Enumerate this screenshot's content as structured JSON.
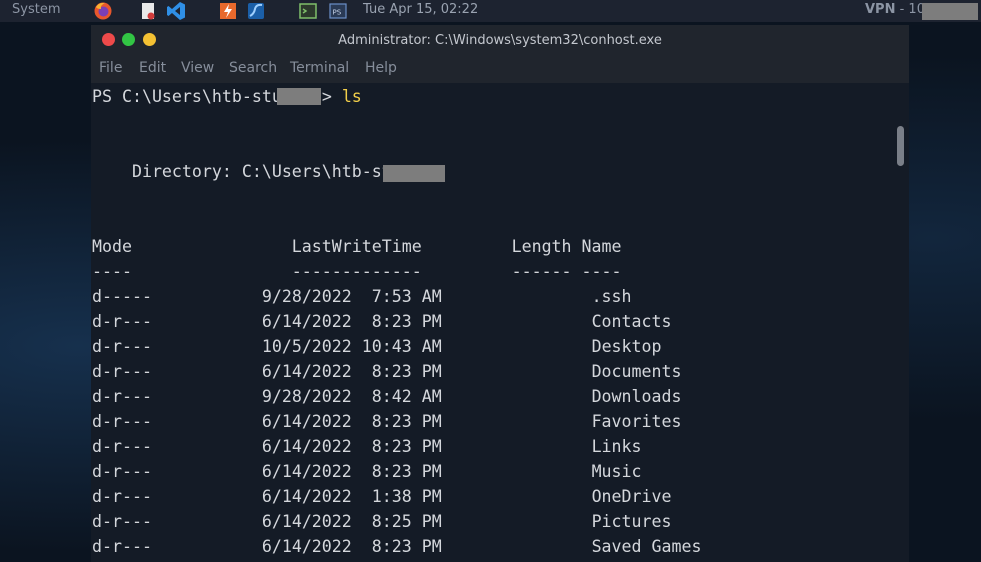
{
  "panel": {
    "menu_label": "System",
    "clock": "Tue Apr 15, 02:22",
    "vpn_label": "VPN",
    "vpn_ip": " - 10."
  },
  "window": {
    "title": "Administrator: C:\\Windows\\system32\\conhost.exe",
    "menu": [
      "File",
      "Edit",
      "View",
      "Search",
      "Terminal",
      "Help"
    ]
  },
  "terminal": {
    "prompt_prefix": "PS C:\\Users\\htb-stu",
    "prompt_suffix": "> ",
    "command": "ls",
    "directory_label": "    Directory: C:\\Users\\htb-st",
    "header": "Mode                LastWriteTime         Length Name",
    "separator": "----                -------------         ------ ----",
    "rows": [
      {
        "mode": "d-----",
        "date": "9/28/2022",
        "time": "7:53 AM",
        "length": "",
        "name": ".ssh"
      },
      {
        "mode": "d-r---",
        "date": "6/14/2022",
        "time": "8:23 PM",
        "length": "",
        "name": "Contacts"
      },
      {
        "mode": "d-r---",
        "date": "10/5/2022",
        "time": "10:43 AM",
        "length": "",
        "name": "Desktop"
      },
      {
        "mode": "d-r---",
        "date": "6/14/2022",
        "time": "8:23 PM",
        "length": "",
        "name": "Documents"
      },
      {
        "mode": "d-r---",
        "date": "9/28/2022",
        "time": "8:42 AM",
        "length": "",
        "name": "Downloads"
      },
      {
        "mode": "d-r---",
        "date": "6/14/2022",
        "time": "8:23 PM",
        "length": "",
        "name": "Favorites"
      },
      {
        "mode": "d-r---",
        "date": "6/14/2022",
        "time": "8:23 PM",
        "length": "",
        "name": "Links"
      },
      {
        "mode": "d-r---",
        "date": "6/14/2022",
        "time": "8:23 PM",
        "length": "",
        "name": "Music"
      },
      {
        "mode": "d-r---",
        "date": "6/14/2022",
        "time": "1:38 PM",
        "length": "",
        "name": "OneDrive"
      },
      {
        "mode": "d-r---",
        "date": "6/14/2022",
        "time": "8:25 PM",
        "length": "",
        "name": "Pictures"
      },
      {
        "mode": "d-r---",
        "date": "6/14/2022",
        "time": "8:23 PM",
        "length": "",
        "name": "Saved Games"
      }
    ]
  },
  "colors": {
    "command": "#f2cf4a",
    "terminal_bg": "#141b26",
    "text": "#d4d7dc"
  }
}
